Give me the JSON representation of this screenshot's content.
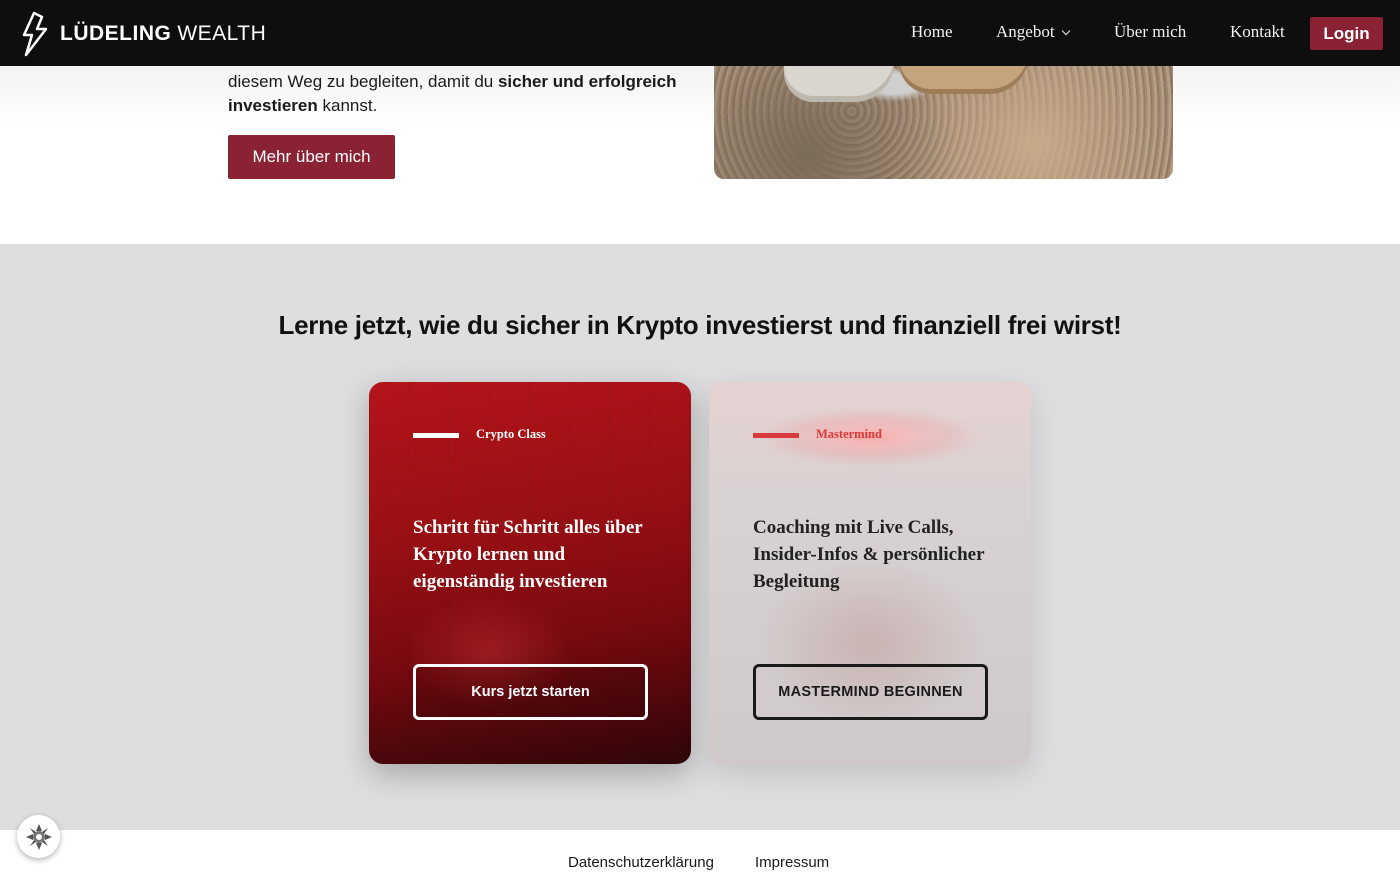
{
  "header": {
    "brand_bold": "LÜDELING",
    "brand_light": "WEALTH",
    "nav": {
      "home": "Home",
      "offer": "Angebot",
      "about": "Über mich",
      "contact": "Kontakt",
      "login": "Login"
    },
    "colors": {
      "background": "#0e0e0e",
      "login_bg": "#8b2233"
    }
  },
  "intro": {
    "line1_partial": "diesem Weg zu begleiten, damit du ",
    "line1_bold": "sicher und erfolgreich",
    "line2_bold": "investieren",
    "line2_rest": " kannst.",
    "button": "Mehr über mich"
  },
  "offers": {
    "title": "Lerne jetzt, wie du sicher in Krypto investierst und finanziell frei wirst!",
    "cards": [
      {
        "tag": "Crypto Class",
        "description": "Schritt für Schritt alles über Krypto lernen und eigenständig investieren",
        "button": "Kurs jetzt starten"
      },
      {
        "tag": "Mastermind",
        "description": "Coaching mit Live Calls, Insider-Infos & persönlicher Begleitung",
        "button": "MASTERMIND BEGINNEN"
      }
    ],
    "colors": {
      "accent": "#8b2233",
      "card_red": "#b3141a",
      "tag_red": "#d93a3a"
    }
  },
  "footer": {
    "privacy": "Datenschutzerklärung",
    "imprint": "Impressum",
    "cookie_icon": "cookie-settings-icon"
  }
}
